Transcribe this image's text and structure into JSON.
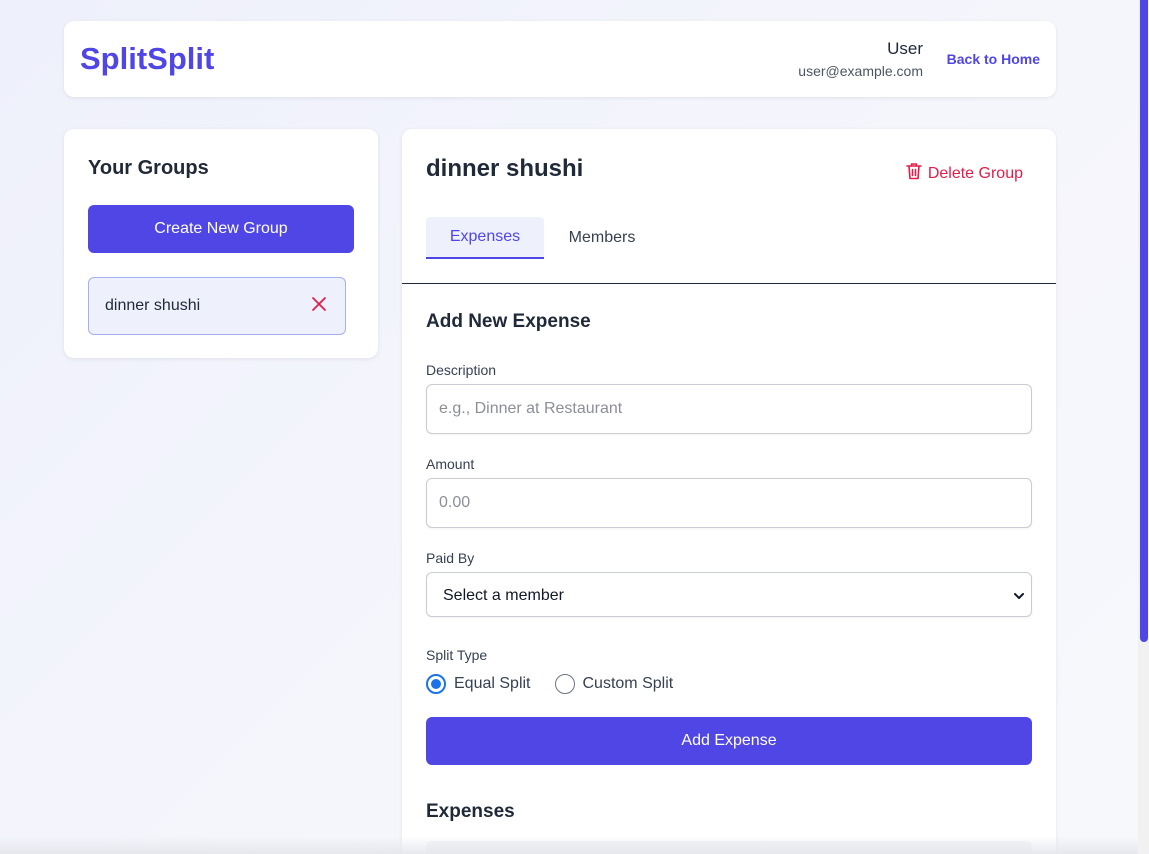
{
  "header": {
    "logo": "SplitSplit",
    "user_name": "User",
    "user_email": "user@example.com",
    "back_link": "Back to Home"
  },
  "sidebar": {
    "title": "Your Groups",
    "create_button": "Create New Group",
    "groups": [
      {
        "name": "dinner shushi"
      }
    ]
  },
  "main": {
    "group_title": "dinner shushi",
    "delete_group": "Delete Group",
    "tabs": [
      {
        "label": "Expenses",
        "active": true
      },
      {
        "label": "Members",
        "active": false
      }
    ],
    "form": {
      "title": "Add New Expense",
      "description_label": "Description",
      "description_placeholder": "e.g., Dinner at Restaurant",
      "amount_label": "Amount",
      "amount_placeholder": "0.00",
      "paid_by_label": "Paid By",
      "paid_by_value": "Select a member",
      "split_type_label": "Split Type",
      "split_options": [
        {
          "label": "Equal Split",
          "checked": true
        },
        {
          "label": "Custom Split",
          "checked": false
        }
      ],
      "submit": "Add Expense"
    },
    "expenses_title": "Expenses"
  },
  "colors": {
    "accent": "#4f46e5",
    "danger": "#e11d48",
    "radio": "#1a73e8"
  }
}
